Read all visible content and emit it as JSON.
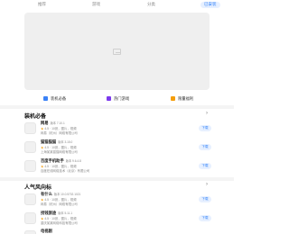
{
  "tabs": [
    "推荐",
    "游戏",
    "分类",
    "已安装"
  ],
  "active_tab_index": 3,
  "quick_links": [
    {
      "label": "装机必备",
      "icon": "pin-icon",
      "color": "#3b82f6"
    },
    {
      "label": "热门游戏",
      "icon": "game-icon",
      "color": "#7c3aed"
    },
    {
      "label": "限量福利",
      "icon": "gift-icon",
      "color": "#f59e0b"
    }
  ],
  "sections": [
    {
      "title": "装机必备",
      "more": "›",
      "apps": [
        {
          "name": "网易",
          "version": "版本 7.10.1",
          "rating_stars": "★",
          "rating": "4.5",
          "tags": "·  10张，图片，视频",
          "company": "网易（杭州）网络有限公司",
          "download": "下载"
        },
        {
          "name": "猫猫猫猫",
          "version": "版本 3.15.0",
          "rating_stars": "★",
          "rating": "4.5",
          "tags": "·  10张，图片，视频",
          "company": "上海某某猫猫网络有限公司",
          "download": "下载"
        },
        {
          "name": "百度手机助手",
          "version": "版本 9.6.4.8",
          "rating_stars": "★",
          "rating": "4.5",
          "tags": "·  10张，图片，视频",
          "company": "百度在线网络技术（北京）有限公司",
          "download": "下载"
        }
      ]
    },
    {
      "title": "人气风向标",
      "more": "›",
      "apps": [
        {
          "name": "有什么",
          "version": "版本 10.0.5702.1021",
          "rating_stars": "★",
          "rating": "4.5",
          "tags": "·  10张，图片，视频",
          "company": "网易（杭州）网络有限公司",
          "download": "下载"
        },
        {
          "name": "找钱旅途",
          "version": "版本 5.11.1",
          "rating_stars": "★",
          "rating": "4.5",
          "tags": "·  10张，图片，视频",
          "company": "重庆某某网络科技有限公司",
          "download": "下载"
        },
        {
          "name": "电视剧",
          "version": "",
          "rating_stars": "",
          "rating": "",
          "tags": "",
          "company": "",
          "download": ""
        }
      ]
    }
  ]
}
